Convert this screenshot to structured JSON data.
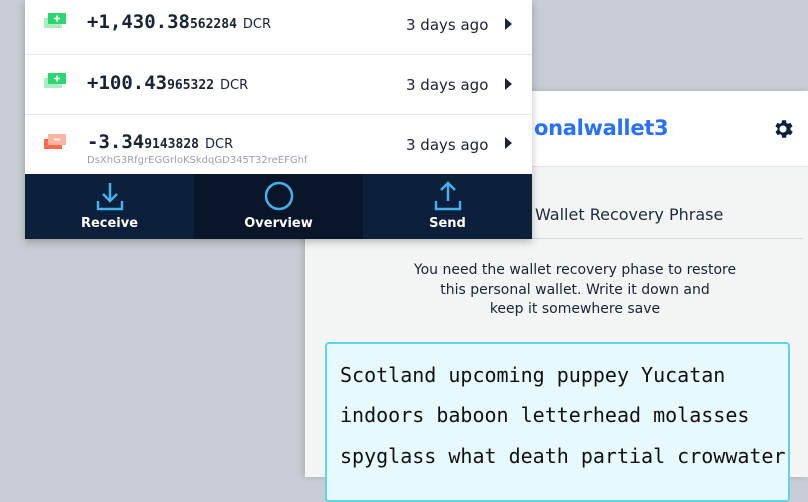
{
  "wallet": {
    "name": "onalwallet3",
    "section_title": "Wallet Recovery Phrase",
    "instructions": [
      "You need the wallet recovery phase to restore",
      "this personal wallet. Write it down and",
      "keep it somewhere save"
    ],
    "phrase_lines": [
      "Scotland upcoming puppey Yucatan",
      "indoors baboon letterhead molasses",
      "spyglass what death partial crowwater"
    ]
  },
  "transactions": [
    {
      "direction": "in",
      "amount_big": "+1,430.38",
      "amount_small": "562284",
      "unit": "DCR",
      "time": "3 days ago",
      "icon": "receive-tx-icon",
      "color": "#2ed573"
    },
    {
      "direction": "in",
      "amount_big": "+100.43",
      "amount_small": "965322",
      "unit": "DCR",
      "time": "3 days ago",
      "icon": "receive-tx-icon",
      "color": "#2ed573"
    },
    {
      "direction": "out",
      "amount_big": "-3.34",
      "amount_small": "9143828",
      "unit": "DCR",
      "time": "3 days ago",
      "icon": "send-tx-icon",
      "color": "#ff6b4a",
      "address": "DsXhG3RfgrEGGrloKSkdqGD345T32reEFGhf"
    }
  ],
  "nav": {
    "receive": "Receive",
    "overview": "Overview",
    "send": "Send"
  },
  "colors": {
    "accent": "#2970ff",
    "nav_bg": "#0c1f3b",
    "phrase_border": "#5fd3ea"
  }
}
